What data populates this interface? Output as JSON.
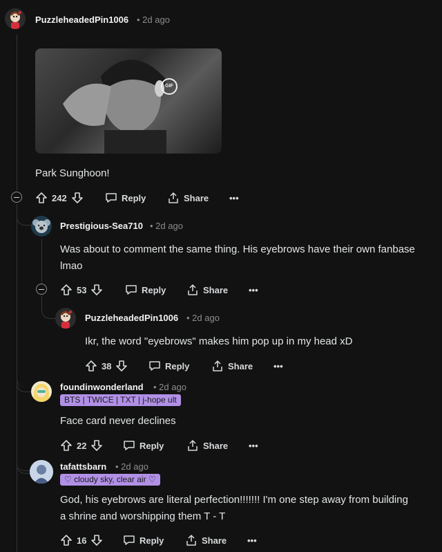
{
  "comments": [
    {
      "username": "PuzzleheadedPin1006",
      "time": "2d ago",
      "body": "Park Sunghoon!",
      "votes": "242",
      "reply_label": "Reply",
      "share_label": "Share",
      "avatar_icon": "snoo-avatar-red-shirt",
      "media": "gif",
      "media_badge": "GIF"
    },
    {
      "username": "Prestigious-Sea710",
      "time": "2d ago",
      "body_lines": [
        "Was about to comment the same thing. His eyebrows have their own fanbase",
        "lmao"
      ],
      "votes": "53",
      "reply_label": "Reply",
      "share_label": "Share",
      "avatar_icon": "snoo-avatar-koala"
    },
    {
      "username": "PuzzleheadedPin1006",
      "time": "2d ago",
      "body": "Ikr, the word \"eyebrows\" makes him pop up in my head xD",
      "votes": "38",
      "reply_label": "Reply",
      "share_label": "Share",
      "avatar_icon": "snoo-avatar-red-shirt"
    },
    {
      "username": "foundinwonderland",
      "time": "2d ago",
      "flair": "BTS | TWICE | TXT | j-hope ult",
      "body": "Face card never declines",
      "votes": "22",
      "reply_label": "Reply",
      "share_label": "Share",
      "avatar_icon": "snoo-avatar-blonde"
    },
    {
      "username": "tafattsbarn",
      "time": "2d ago",
      "flair": "♡ cloudy sky, clear air ♡",
      "body_lines": [
        "God, his eyebrows are literal perfection!!!!!!! I'm one step away from building",
        "a shrine and worshipping them T - T"
      ],
      "votes": "16",
      "reply_label": "Reply",
      "share_label": "Share",
      "avatar_icon": "photo-avatar"
    }
  ],
  "colors": {
    "background": "#121212",
    "text": "#d7dadc",
    "muted": "#8b8d8f",
    "flair": "#b190e6",
    "thread_line": "#343536"
  }
}
